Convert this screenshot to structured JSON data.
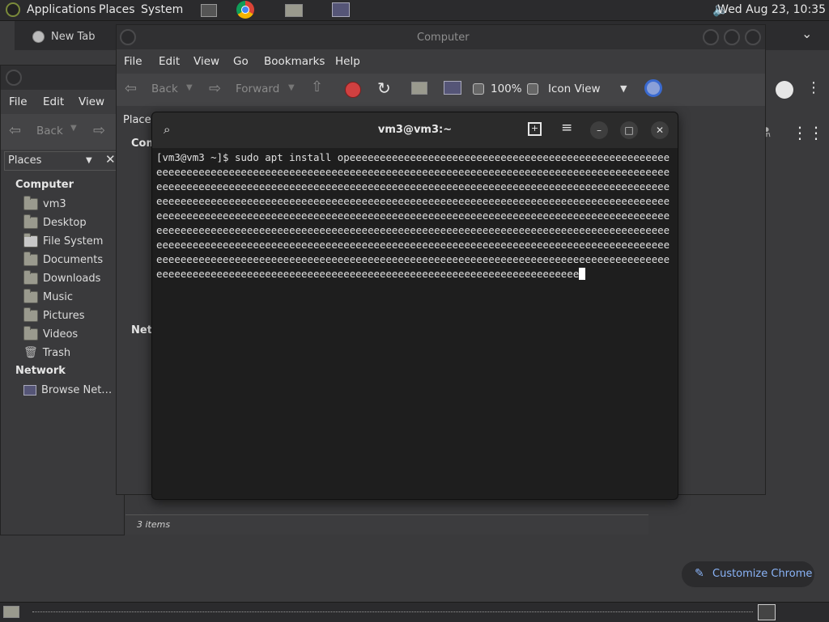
{
  "top_panel": {
    "menus": [
      "Applications",
      "Places",
      "System"
    ],
    "clock": "Wed Aug 23, 10:35"
  },
  "chrome": {
    "tab_label": "New Tab",
    "customize_label": "Customize Chrome"
  },
  "fm_left": {
    "menus": [
      "File",
      "Edit",
      "View"
    ],
    "back_label": "Back",
    "places_label": "Places",
    "sections": {
      "computer": "Computer",
      "network": "Network"
    },
    "computer_items": [
      "vm3",
      "Desktop",
      "File System",
      "Documents",
      "Downloads",
      "Music",
      "Pictures",
      "Videos",
      "Trash"
    ],
    "network_items": [
      "Browse Net…"
    ]
  },
  "fm_comp": {
    "title": "Computer",
    "menus": [
      "File",
      "Edit",
      "View",
      "Go",
      "Bookmarks",
      "Help"
    ],
    "back_label": "Back",
    "forward_label": "Forward",
    "zoom": "100%",
    "view_mode": "Icon View",
    "places_partial": "Places",
    "col_partial_comp": "Com",
    "col_partial_net": "Netw",
    "status": "3 items"
  },
  "terminal": {
    "title": "vm3@vm3:~",
    "prompt": "[vm3@vm3 ~]$ ",
    "command": "sudo apt install opeeeeeeeeeeeeeeeeeeeeeeeeeeeeeeeeeeeeeeeeeeeeeeeeeeeeeeeeeeeeeeeeeeeeeeeeeeeeeeeeeeeeeeeeeeeeeeeeeeeeeeeeeeeeeeeeeeeeeeeeeeeeeeeeeeeeeeeeeeeeeeeeeeeeeeeeeeeeeeeeeeeeeeeeeeeeeeeeeeeeeeeeeeeeeeeeeeeeeeeeeeeeeeeeeeeeeeeeeeeeeeeeeeeeeeeeeeeeeeeeeeeeeeeeeeeeeeeeeeeeeeeeeeeeeeeeeeeeeeeeeeeeeeeeeeeeeeeeeeeeeeeeeeeeeeeeeeeeeeeeeeeeeeeeeeeeeeeeeeeeeeeeeeeeeeeeeeeeeeeeeeeeeeeeeeeeeeeeeeeeeeeeeeeeeeeeeeeeeeeeeeeeeeeeeeeeeeeeeeeeeeeeeeeeeeeeeeeeeeeeeeeeeeeeeeeeeeeeeeeeeeeeeeeeeeeeeeeeeeeeeeeeeeeeeeeeeeeeeeeeeeeeeeeeeeeeeeeeeeeeeeeeeeeeeeeeeeeeeeeeeeeeeeeeeeeeeeeeeeeeeeeeeeeeeeeeeeeeeeeeeeeeeeeeeeeeeeeeeeeeeeeeeeeeeeeeeeeeeeeeeeeeeeeeeeeeeeeeeeeeeeeeeeeeeeeeeeeeeeeeeeeeeeeeeeeeeeeeeeeeeeeeeeeeeeeeeeeeeeeeeeeeeeeeeeeeeeeeee"
  },
  "colors": {
    "accent_blue": "#8ab4f8",
    "stop_red": "#d04040"
  },
  "icons": {
    "terminal_search": "search-icon",
    "new_tab": "new-tab-icon",
    "hamburger": "menu-icon",
    "minimize": "minimize-icon",
    "maximize": "maximize-icon",
    "close": "close-icon"
  }
}
